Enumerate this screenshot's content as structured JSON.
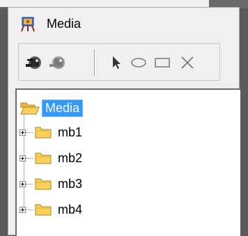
{
  "window": {
    "title": "Media",
    "title_icon": "media-app-icon"
  },
  "toolbar": {
    "buttons": [
      {
        "name": "connect-tool-icon",
        "tooltip": ""
      },
      {
        "name": "disconnect-tool-icon",
        "tooltip": ""
      },
      {
        "name": "pointer-tool-icon",
        "tooltip": ""
      },
      {
        "name": "ellipse-tool-icon",
        "tooltip": ""
      },
      {
        "name": "rectangle-tool-icon",
        "tooltip": ""
      },
      {
        "name": "delete-tool-icon",
        "tooltip": ""
      }
    ]
  },
  "tree": {
    "root": {
      "label": "Media",
      "icon": "open-folder-icon",
      "selected": true
    },
    "children": [
      {
        "label": "mb1",
        "icon": "folder-icon"
      },
      {
        "label": "mb2",
        "icon": "folder-icon"
      },
      {
        "label": "mb3",
        "icon": "folder-icon"
      },
      {
        "label": "mb4",
        "icon": "folder-icon"
      }
    ]
  },
  "colors": {
    "selection": "#3399ff",
    "folder": "#f7d15a",
    "window_bg": "#f0f0f0"
  }
}
